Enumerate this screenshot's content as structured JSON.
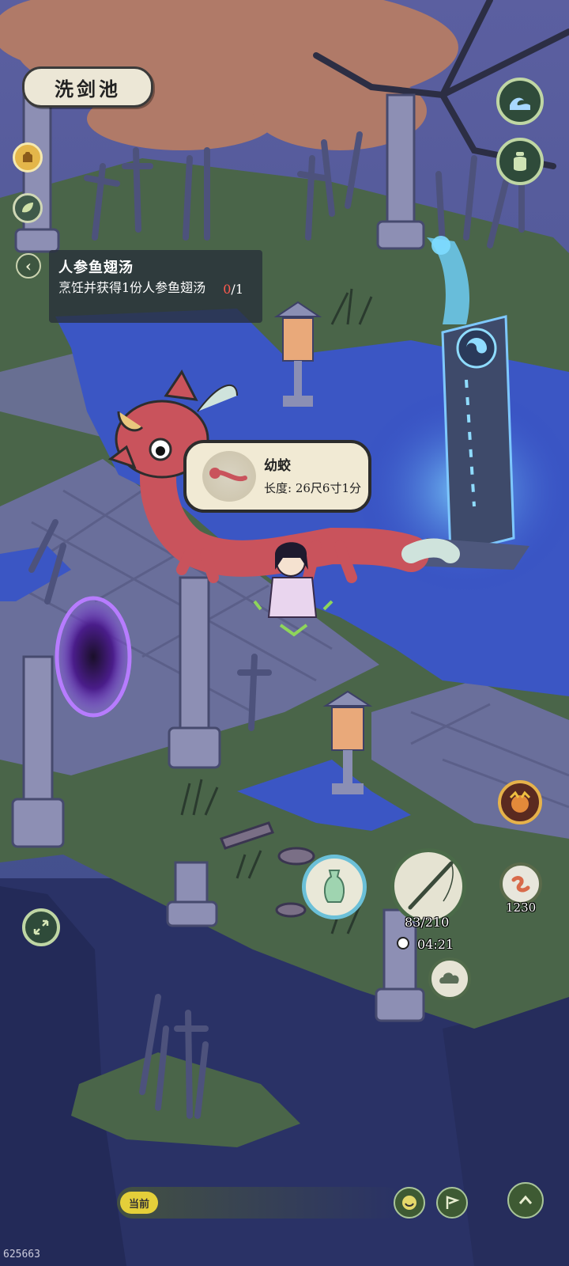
{
  "location": {
    "name": "洗剑池"
  },
  "quest": {
    "title": "人参鱼翅汤",
    "description": "烹饪并获得1份人参鱼翅汤",
    "progress_current": "0",
    "progress_total": "/1"
  },
  "creature": {
    "name": "幼蛟",
    "length_text": "长度: 26尺6寸1分"
  },
  "hud": {
    "item_count": "1230",
    "energy": "83/210",
    "timer": "04:21"
  },
  "chat": {
    "channel_label": "当前"
  },
  "watermark": "625663",
  "colors": {
    "water": "#3a56c8",
    "grass": "#4d6a4a",
    "stone": "#6f76a0",
    "tree": "#b57c6a",
    "dragon": "#c9535c",
    "portal": "#7a3bd8",
    "accent_green": "#bfd6a4",
    "progress_red": "#ff5a4e"
  },
  "icons": {
    "wave": "wave-icon",
    "jar": "jar-icon",
    "bag": "bag-icon",
    "leaf": "leaf-icon",
    "back": "chevron-left-icon",
    "vase": "vase-icon",
    "cloud": "cloud-icon",
    "expand": "expand-icon",
    "smile": "smile-icon",
    "flag": "flag-icon",
    "up": "chevron-up-icon"
  }
}
